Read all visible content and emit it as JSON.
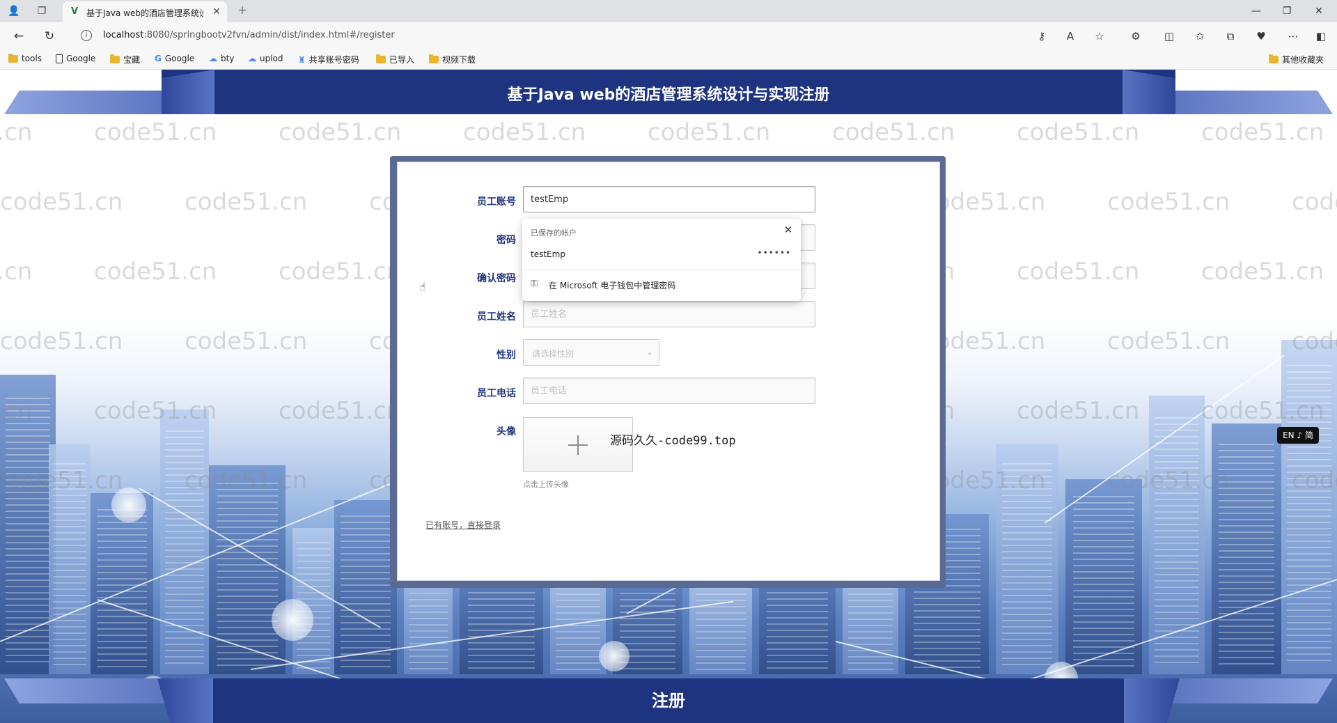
{
  "browser": {
    "tab_title": "基于Java web的酒店管理系统设计",
    "url_host": "localhost",
    "url_rest": ":8080/springbootv2fvn/admin/dist/index.html#/register",
    "bookmarks": [
      "tools",
      "Google",
      "宝藏",
      "Google",
      "bty",
      "uplod",
      "共享账号密码",
      "已导入",
      "视频下载"
    ],
    "other_bookmarks": "其他收藏夹"
  },
  "page": {
    "title": "基于Java web的酒店管理系统设计与实现注册",
    "watermark": "code51.cn",
    "overlay_text": "源码久久-code99.top",
    "lang_badge": "EN ♪ 简",
    "submit_label": "注册",
    "colors": {
      "header": "#1e3480",
      "label": "#1e3480",
      "card_border": "#5a6a92"
    }
  },
  "form": {
    "account_label": "员工账号",
    "account_value": "testEmp",
    "password_label": "密码",
    "confirm_label": "确认密码",
    "name_label": "员工姓名",
    "name_placeholder": "员工姓名",
    "gender_label": "性别",
    "gender_placeholder": "请选择性别",
    "phone_label": "员工电话",
    "phone_placeholder": "员工电话",
    "avatar_label": "头像",
    "avatar_hint": "点击上传头像",
    "login_link": "已有账号，直接登录"
  },
  "autofill": {
    "header": "已保存的帐户",
    "username": "testEmp",
    "password_mask": "••••••",
    "manage": "在 Microsoft 电子钱包中管理密码"
  }
}
